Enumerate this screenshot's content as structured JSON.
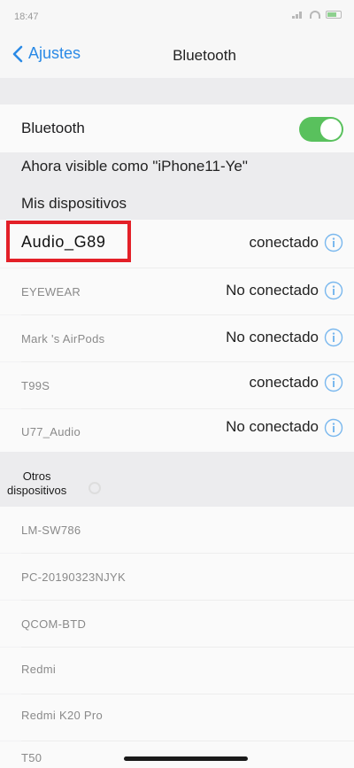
{
  "status_bar": {
    "time": "18:47"
  },
  "nav": {
    "back_label": "Ajustes",
    "title": "Bluetooth"
  },
  "bluetooth": {
    "label": "Bluetooth",
    "toggle_on": true,
    "accent": "#59c15d"
  },
  "visibility_text": "Ahora visible como \"iPhone11-Ye\"",
  "my_devices": {
    "header": "Mis dispositivos",
    "items": [
      {
        "name": "Audio_G89",
        "status": "conectado"
      },
      {
        "name": "EYEWEAR",
        "status": "No conectado"
      },
      {
        "name": "Mark 's AirPods",
        "status": "No conectado"
      },
      {
        "name": "T99S",
        "status": "conectado"
      },
      {
        "name": "U77_Audio",
        "status": "No conectado"
      }
    ]
  },
  "other_devices": {
    "header_line1": "Otros",
    "header_line2": "dispositivos",
    "items": [
      {
        "name": "LM-SW786"
      },
      {
        "name": "PC-20190323NJYK"
      },
      {
        "name": "QCOM-BTD"
      },
      {
        "name": "Redmi"
      },
      {
        "name": "Redmi K20 Pro"
      },
      {
        "name": "T50"
      }
    ]
  },
  "colors": {
    "link": "#2b8ae6",
    "highlight": "#e32028",
    "info": "#7ab8ee"
  }
}
